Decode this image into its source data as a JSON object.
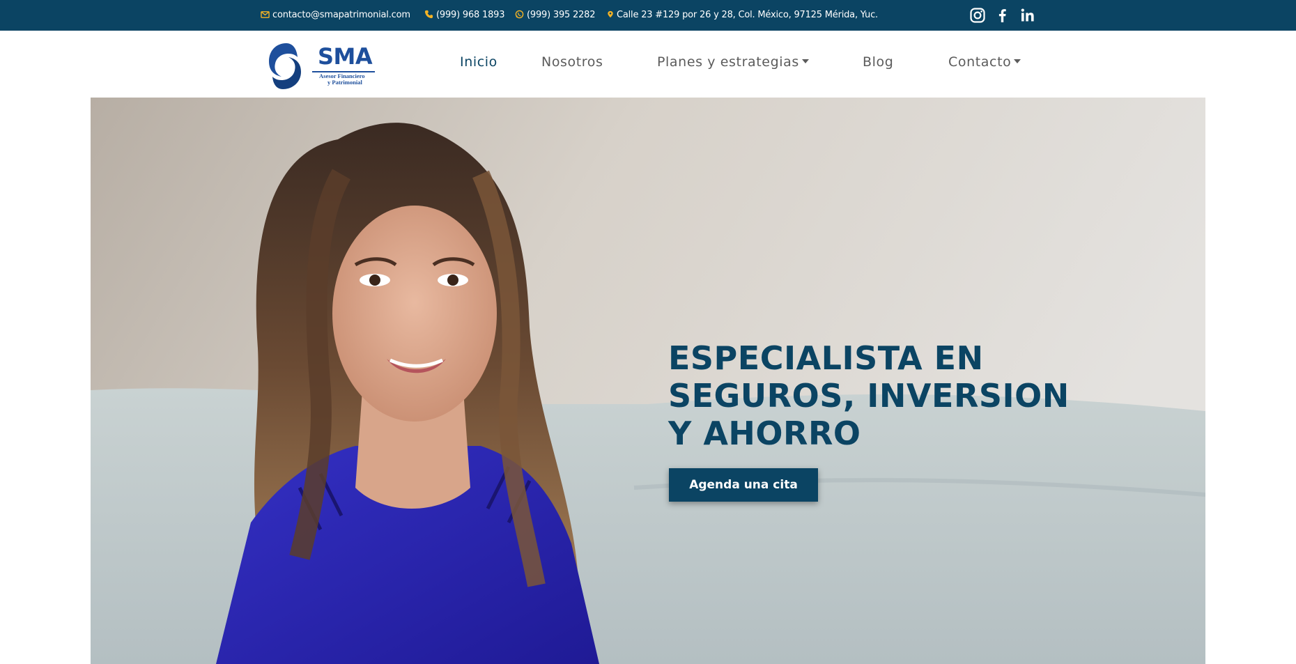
{
  "topbar": {
    "email": "contacto@smapatrimonial.com",
    "phone": "(999) 968 1893",
    "whatsapp": "(999) 395 2282",
    "address": "Calle 23 #129 por 26 y 28, Col. México, 97125 Mérida, Yuc.",
    "icons": {
      "email": "envelope-icon",
      "phone": "phone-icon",
      "whatsapp": "whatsapp-icon",
      "address": "map-marker-icon"
    },
    "social": [
      "instagram-icon",
      "facebook-icon",
      "linkedin-icon"
    ],
    "icon_color": "#f5b324",
    "background": "#0b4463"
  },
  "logo": {
    "name": "SMA",
    "tagline_line1": "Asesor Financiero",
    "tagline_line2": "y Patrimonial"
  },
  "nav": {
    "items": [
      {
        "label": "Inicio",
        "active": true
      },
      {
        "label": "Nosotros"
      },
      {
        "label": "Planes y estrategias",
        "dropdown": true
      },
      {
        "label": "Blog"
      },
      {
        "label": "Contacto",
        "dropdown": true
      }
    ]
  },
  "hero": {
    "headline_line1": "ESPECIALISTA EN",
    "headline_line2": "SEGUROS, INVERSION",
    "headline_line3": "Y AHORRO",
    "cta_label": "Agenda una cita",
    "accent": "#0b4463"
  }
}
